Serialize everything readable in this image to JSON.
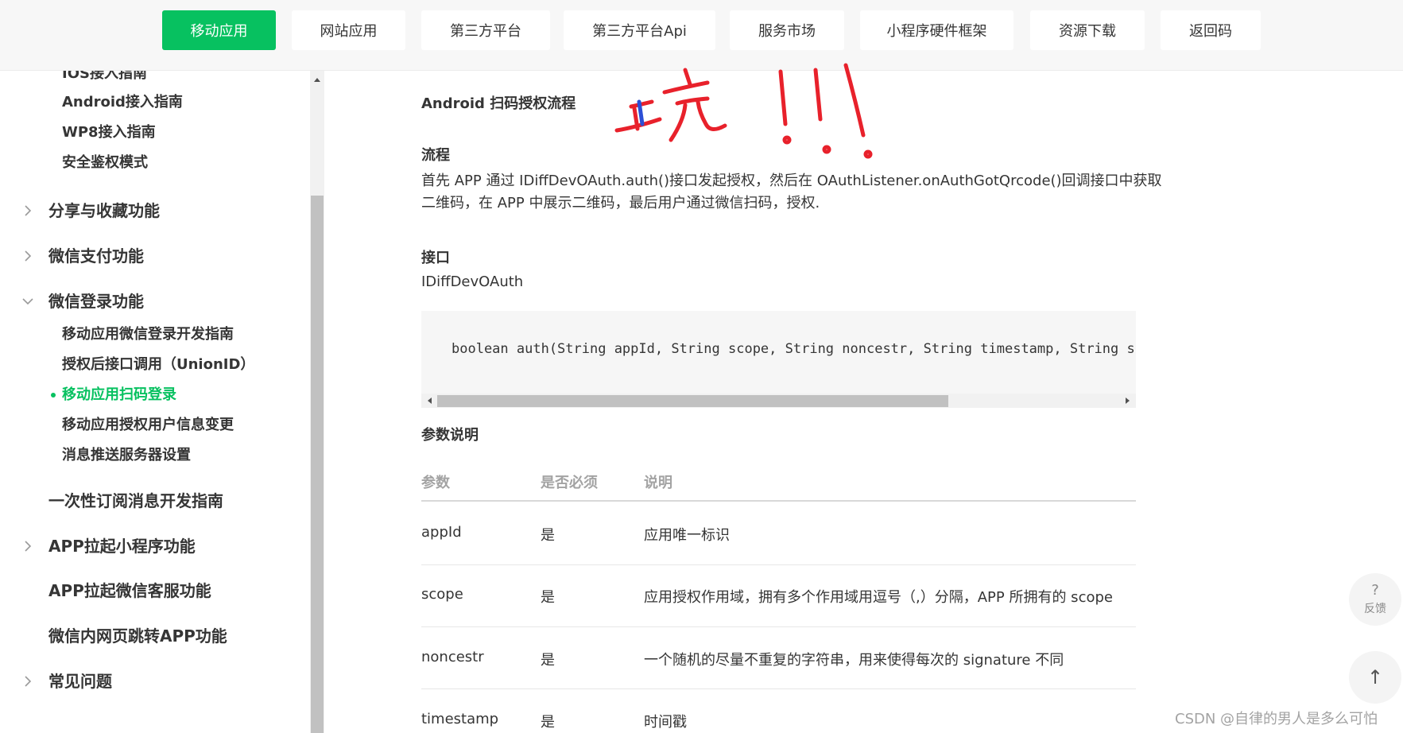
{
  "nav": {
    "tabs": [
      "移动应用",
      "网站应用",
      "第三方平台",
      "第三方平台Api",
      "服务市场",
      "小程序硬件框架",
      "资源下载",
      "返回码"
    ],
    "active_index": 0
  },
  "sidebar": {
    "sub_items_top": [
      "IOS接入指南",
      "Android接入指南",
      "WP8接入指南",
      "安全鉴权模式"
    ],
    "main_share": "分享与收藏功能",
    "main_pay": "微信支付功能",
    "main_login": "微信登录功能",
    "login_children": [
      "移动应用微信登录开发指南",
      "授权后接口调用（UnionID）",
      "移动应用扫码登录",
      "移动应用授权用户信息变更",
      "消息推送服务器设置"
    ],
    "active_child": "移动应用扫码登录",
    "main_subscribe": "一次性订阅消息开发指南",
    "main_miniprogram": "APP拉起小程序功能",
    "main_kefu": "APP拉起微信客服功能",
    "main_webjump": "微信内网页跳转APP功能",
    "main_faq": "常见问题"
  },
  "content": {
    "title": "Android 扫码授权流程",
    "flow_heading": "流程",
    "flow_text_1": "首先 APP 通过 IDiffDevOAuth.auth()接口发起授权，然后在 OAuthListener.onAuthGotQrcode()回调接口中获取",
    "flow_text_2": "二维码，在 APP 中展示二维码，最后用户通过微信扫码，授权.",
    "api_heading": "接口",
    "api_name": "IDiffDevOAuth",
    "code": "boolean auth(String appId, String scope, String noncestr, String timestamp, String signatu",
    "params_heading": "参数说明",
    "table": {
      "headers": [
        "参数",
        "是否必须",
        "说明"
      ],
      "rows": [
        {
          "param": "appId",
          "required": "是",
          "desc": "应用唯一标识"
        },
        {
          "param": "scope",
          "required": "是",
          "desc": "应用授权作用域，拥有多个作用域用逗号（,）分隔，APP 所拥有的 scope"
        },
        {
          "param": "noncestr",
          "required": "是",
          "desc": "一个随机的尽量不重复的字符串，用来使得每次的 signature 不同"
        },
        {
          "param": "timestamp",
          "required": "是",
          "desc": "时间戳"
        }
      ]
    }
  },
  "annotation": {
    "text": "坑!!!",
    "color": "#e8212b"
  },
  "float": {
    "feedback_label": "反馈",
    "feedback_glyph": "?",
    "top_glyph": "↑"
  },
  "watermark": "CSDN @自律的男人是多么可怕",
  "colors": {
    "accent": "#07c160",
    "text": "#353535",
    "muted": "#a3a3a3"
  }
}
